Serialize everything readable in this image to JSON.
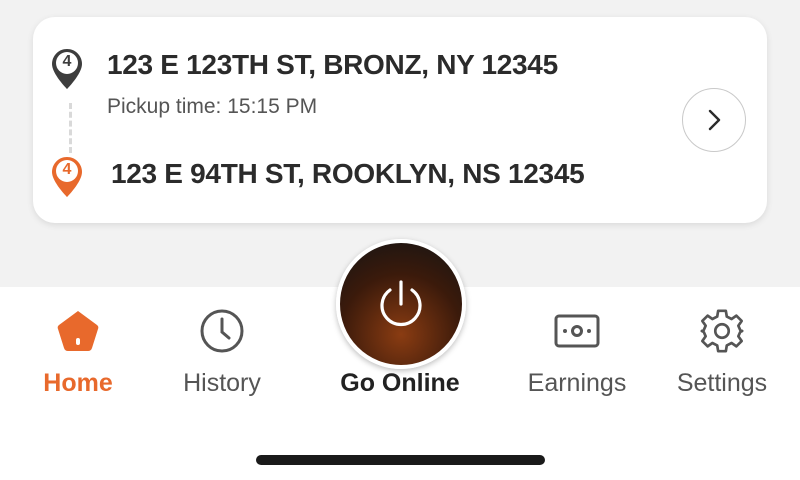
{
  "trip": {
    "pickup": {
      "stop_number": "4",
      "address": "123 E 123TH ST, BRONZ, NY 12345",
      "time_text": "Pickup time: 15:15 PM"
    },
    "dropoff": {
      "stop_number": "4",
      "address": "123 E 94TH ST, ROOKLYN, NS 12345"
    },
    "details_icon": "chevron-right-icon"
  },
  "nav": {
    "items": [
      {
        "label": "Home",
        "icon": "home-icon",
        "active": true
      },
      {
        "label": "History",
        "icon": "clock-icon",
        "active": false
      },
      {
        "label": "Go Online",
        "icon": "power-icon",
        "active": false
      },
      {
        "label": "Earnings",
        "icon": "money-icon",
        "active": false
      },
      {
        "label": "Settings",
        "icon": "gear-icon",
        "active": false
      }
    ]
  },
  "colors": {
    "accent": "#e8692c",
    "text_dark": "#2b2b2b",
    "text_muted": "#555555",
    "background": "#f2f2f2"
  }
}
